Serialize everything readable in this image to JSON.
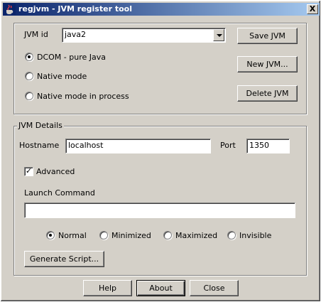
{
  "window": {
    "title": "regjvm - JVM register tool",
    "icon": "java-cup-icon",
    "close_glyph": "X"
  },
  "jvm_group": {
    "jvm_id_label": "JVM id",
    "jvm_id_value": "java2",
    "save_label": "Save JVM",
    "new_label": "New JVM...",
    "delete_label": "Delete JVM",
    "modes": [
      {
        "label": "DCOM - pure Java",
        "checked": true
      },
      {
        "label": "Native mode",
        "checked": false
      },
      {
        "label": "Native mode in process",
        "checked": false
      }
    ]
  },
  "details": {
    "legend": "JVM Details",
    "hostname_label": "Hostname",
    "hostname_value": "localhost",
    "port_label": "Port",
    "port_value": "1350",
    "advanced_label": "Advanced",
    "advanced_checked": true,
    "launch_label": "Launch Command",
    "launch_value": "",
    "window_modes": [
      {
        "label": "Normal",
        "checked": true
      },
      {
        "label": "Minimized",
        "checked": false
      },
      {
        "label": "Maximized",
        "checked": false
      },
      {
        "label": "Invisible",
        "checked": false
      }
    ],
    "generate_label": "Generate Script..."
  },
  "footer": {
    "help_label": "Help",
    "about_label": "About",
    "close_label": "Close"
  }
}
